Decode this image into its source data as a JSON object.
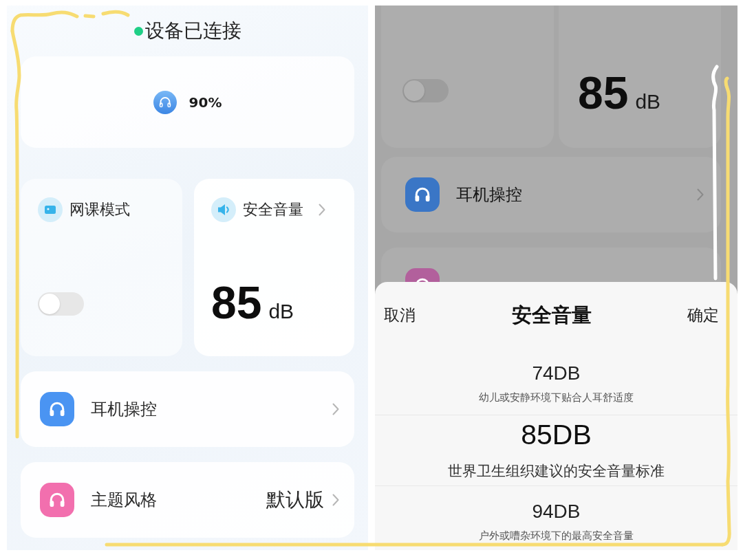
{
  "left_screen": {
    "status": {
      "text": "设备已连接"
    },
    "battery": {
      "reading": "90%"
    },
    "online_class": {
      "label": "网课模式",
      "on": false
    },
    "safe_volume": {
      "label": "安全音量",
      "value": "85",
      "unit": "dB"
    },
    "menu_rows": [
      {
        "label": "耳机操控",
        "color": "#4a94f2"
      },
      {
        "label": "主题风格",
        "value": "默认版",
        "color": "#f26fae"
      }
    ]
  },
  "right_screen": {
    "background": {
      "online_class": {
        "on": false
      },
      "safe_volume": {
        "value": "85",
        "unit": "dB"
      },
      "menu_rows": [
        {
          "label": "耳机操控",
          "color": "#3a76c6"
        },
        {
          "color": "#b2609c"
        }
      ]
    },
    "picker": {
      "cancel": "取消",
      "title": "安全音量",
      "confirm": "确定",
      "options": [
        {
          "value": "74DB",
          "note": "幼儿或安静环境下贴合人耳舒适度",
          "selected": false
        },
        {
          "value": "85DB",
          "note": "世界卫生组织建议的安全音量标准",
          "selected": true
        },
        {
          "value": "94DB",
          "note": "户外或嘈杂环境下的最高安全音量",
          "selected": false
        }
      ]
    }
  }
}
